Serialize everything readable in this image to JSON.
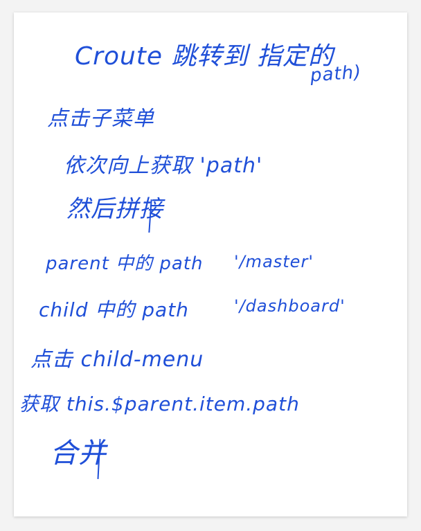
{
  "note": {
    "line1": "Croute 跳转到 指定的",
    "line2": "path)",
    "line3": "点击子菜单",
    "line4": "依次向上获取 'path'",
    "line5": "然后拼接",
    "line6": "parent 中的 path",
    "line6_value": "'/master'",
    "line7": "child 中的 path",
    "line7_value": "'/dashboard'",
    "line8": "点击 child-menu",
    "line9": "获取 this.$parent.item.path",
    "line10": "合并"
  },
  "colors": {
    "ink": "#1f4fd8",
    "paper": "#ffffff",
    "background": "#f3f3f3"
  }
}
